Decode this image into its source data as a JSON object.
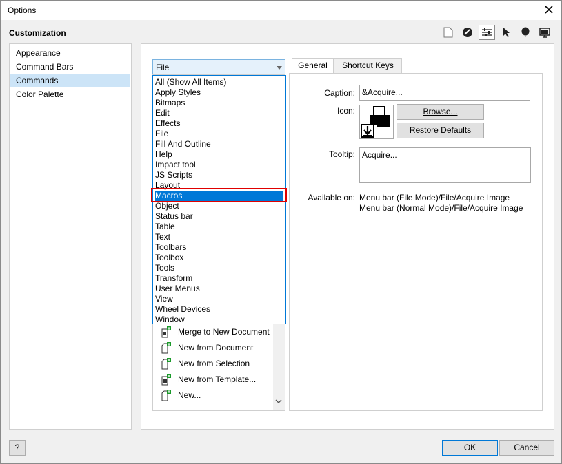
{
  "window": {
    "title": "Options",
    "close_glyph": "✕"
  },
  "section_title": "Customization",
  "header_icons": [
    "page-icon",
    "color-management-icon",
    "customization-icon",
    "pointer-tool-icon",
    "balloon-icon",
    "display-icon"
  ],
  "nav": {
    "items": [
      "Appearance",
      "Command Bars",
      "Commands",
      "Color Palette"
    ],
    "selected": "Commands"
  },
  "category_combo": {
    "value": "File"
  },
  "dropdown": {
    "options": [
      "All (Show All Items)",
      "Apply Styles",
      "Bitmaps",
      "Edit",
      "Effects",
      "File",
      "Fill And Outline",
      "Help",
      "Impact tool",
      "JS Scripts",
      "Layout",
      "Macros",
      "Object",
      "Status bar",
      "Table",
      "Text",
      "Toolbars",
      "Toolbox",
      "Tools",
      "Transform",
      "User Menus",
      "View",
      "Wheel Devices",
      "Window"
    ],
    "highlighted": "Macros"
  },
  "command_list": {
    "items": [
      "Merge to New Document",
      "New from Document",
      "New from Selection",
      "New from Template...",
      "New..."
    ]
  },
  "tabs": {
    "general": "General",
    "shortcut_keys": "Shortcut Keys",
    "active": "General"
  },
  "general": {
    "caption_label": "Caption:",
    "caption_value": "&Acquire...",
    "icon_label": "Icon:",
    "browse_label": "Browse...",
    "restore_label": "Restore Defaults",
    "tooltip_label": "Tooltip:",
    "tooltip_value": "Acquire...",
    "available_label": "Available on:",
    "available_lines": [
      "Menu bar (File Mode)/File/Acquire Image",
      "Menu bar (Normal Mode)/File/Acquire Image"
    ]
  },
  "footer": {
    "help_label": "?",
    "ok_label": "OK",
    "cancel_label": "Cancel"
  },
  "colors": {
    "accent": "#0078d7",
    "highlight_border": "#e00000",
    "nav_selected": "#cce4f7"
  }
}
